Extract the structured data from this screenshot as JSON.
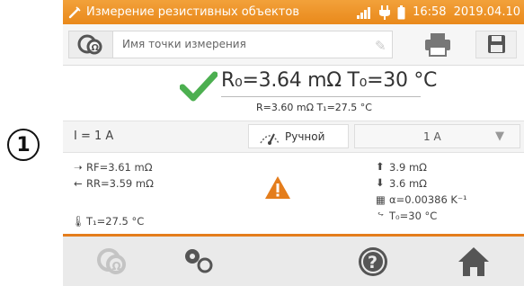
{
  "callout": "1",
  "status": {
    "title": "Измерение резистивных объектов",
    "time": "16:58",
    "date": "2019.04.10"
  },
  "point": {
    "placeholder": "Имя точки измерения"
  },
  "result": {
    "main": "R₀=3.64 mΩ T₀=30 °C",
    "sub": "R=3.60 mΩ T₁=27.5 °C"
  },
  "settings": {
    "current": "I = 1 A",
    "mode": "Ручной",
    "range": "1 A"
  },
  "details": {
    "rf": "RF=3.61 mΩ",
    "rr": "RR=3.59 mΩ",
    "t1": "T₁=27.5 °C",
    "upper": "3.9 mΩ",
    "lower": "3.6 mΩ",
    "alpha": "α=0.00386 K⁻¹",
    "t0": "T₀=30 °C"
  },
  "colors": {
    "accent": "#e9891b",
    "ok": "#4caf50",
    "warn": "#e47d1c"
  }
}
